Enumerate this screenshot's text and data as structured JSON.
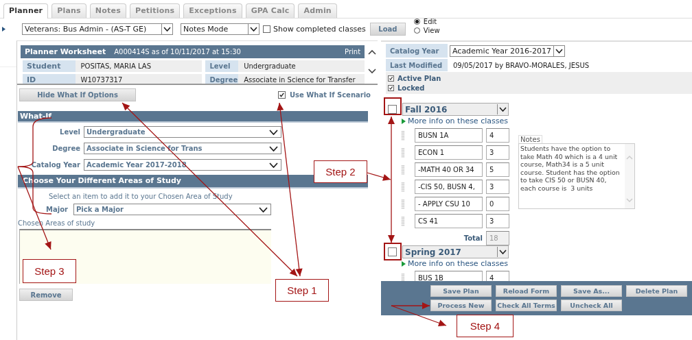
{
  "tabs": [
    {
      "label": "Planner",
      "selected": true
    },
    {
      "label": "Plans",
      "selected": false
    },
    {
      "label": "Notes",
      "selected": false
    },
    {
      "label": "Petitions",
      "selected": false
    },
    {
      "label": "Exceptions",
      "selected": false
    },
    {
      "label": "GPA Calc",
      "selected": false
    },
    {
      "label": "Admin",
      "selected": false
    }
  ],
  "toolbar": {
    "plan_select": "Veterans: Bus Admin - (AS-T GE)",
    "mode_select": "Notes Mode",
    "show_completed": {
      "label": "Show completed classes",
      "checked": false
    },
    "load_button": "Load",
    "view_mode": [
      {
        "label": "Edit",
        "selected": true
      },
      {
        "label": "View",
        "selected": false
      }
    ]
  },
  "worksheet": {
    "title": "Planner Worksheet",
    "subtitle": "A000414S as of 10/11/2017 at 15:30",
    "print": "Print",
    "rows": [
      [
        {
          "label": "Student",
          "value": "POSITAS, MARIA LAS"
        },
        {
          "label": "Level",
          "value": "Undergraduate"
        }
      ],
      [
        {
          "label": "ID",
          "value": "W10737317"
        },
        {
          "label": "Degree",
          "value": "Associate in Science for Transfer"
        }
      ]
    ]
  },
  "what_if": {
    "hide_button": "Hide What If Options",
    "use_scenario": {
      "label": "Use What If Scenario",
      "checked": true
    },
    "header": "What-If",
    "fields": [
      {
        "label": "Level",
        "value": "Undergraduate"
      },
      {
        "label": "Degree",
        "value": "Associate in Science for Trans"
      },
      {
        "label": "Catalog Year",
        "value": "Academic Year 2017-2018"
      }
    ],
    "areas_header": "Choose Your Different Areas of Study",
    "hint": "Select an item to add it to your Chosen Area of Study",
    "major": {
      "label": "Major",
      "value": "Pick a Major"
    },
    "chosen_label": "Chosen Areas of study",
    "remove_button": "Remove"
  },
  "plan": {
    "catalog_year": {
      "label": "Catalog Year",
      "value": "Academic Year 2016-2017"
    },
    "last_modified": {
      "label": "Last Modified",
      "value": "09/05/2017 by BRAVO-MORALES, JESUS"
    },
    "flags": [
      {
        "label": "Active Plan",
        "checked": true
      },
      {
        "label": "Locked",
        "checked": true
      }
    ],
    "terms": [
      {
        "name": "Fall 2016",
        "checked": false,
        "more_info": "More info on these classes",
        "classes": [
          {
            "course": "BUSN 1A",
            "units": "4"
          },
          {
            "course": "ECON 1",
            "units": "3"
          },
          {
            "course": "-MATH 40 OR 34",
            "units": "5"
          },
          {
            "course": "-CIS 50, BUSN 4,",
            "units": "3"
          },
          {
            "course": "- APPLY CSU 10",
            "units": "0"
          },
          {
            "course": "CS 41",
            "units": "3"
          }
        ],
        "notes_label": "Notes",
        "notes": "Students have the option to take Math 40 which is a 4 unit course, Math34 is a 5 unit course. Student has the option to take CIS 50 or BUSN 40, each course is  3 units",
        "total_label": "Total",
        "total": "18"
      },
      {
        "name": "Spring 2017",
        "checked": false,
        "more_info": "More info on these classes",
        "classes": [
          {
            "course": "BUS 1B",
            "units": "4"
          }
        ]
      }
    ],
    "buttons": [
      [
        "Save Plan",
        "Reload Form",
        "Save As...",
        "Delete Plan"
      ],
      [
        "Process New",
        "Check All Terms",
        "Uncheck All"
      ]
    ]
  },
  "annotations": [
    {
      "label": "Step 1"
    },
    {
      "label": "Step 2"
    },
    {
      "label": "Step 3"
    },
    {
      "label": "Step 4"
    }
  ]
}
